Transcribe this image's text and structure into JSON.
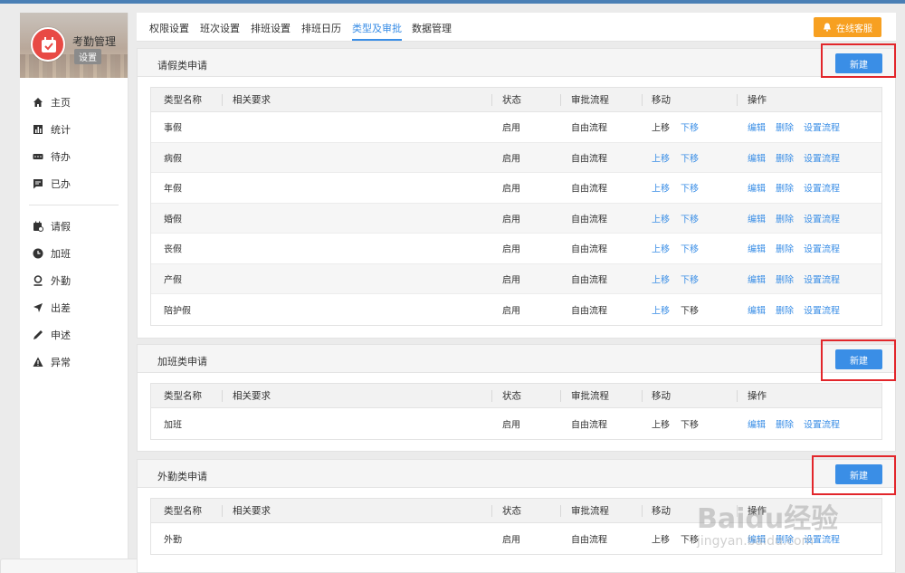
{
  "app": {
    "title": "考勤管理",
    "badge": "设置"
  },
  "nav": {
    "primary": [
      {
        "label": "主页",
        "icon": "home-icon"
      },
      {
        "label": "统计",
        "icon": "chart-icon"
      },
      {
        "label": "待办",
        "icon": "todo-icon"
      },
      {
        "label": "已办",
        "icon": "done-icon"
      }
    ],
    "secondary": [
      {
        "label": "请假",
        "icon": "leave-icon"
      },
      {
        "label": "加班",
        "icon": "clock-icon"
      },
      {
        "label": "外勤",
        "icon": "location-icon"
      },
      {
        "label": "出差",
        "icon": "plane-icon"
      },
      {
        "label": "申述",
        "icon": "pen-icon"
      },
      {
        "label": "异常",
        "icon": "warning-icon"
      }
    ]
  },
  "tabs": [
    "权限设置",
    "班次设置",
    "排班设置",
    "排班日历",
    "类型及审批",
    "数据管理"
  ],
  "active_tab": "类型及审批",
  "service_button": "在线客服",
  "columns": [
    "类型名称",
    "相关要求",
    "状态",
    "审批流程",
    "移动",
    "操作"
  ],
  "actions": {
    "up": "上移",
    "down": "下移",
    "edit": "编辑",
    "delete": "删除",
    "set_flow": "设置流程"
  },
  "sections": [
    {
      "title": "请假类申请",
      "new_button": "新建",
      "rows": [
        {
          "name": "事假",
          "status": "启用",
          "flow": "自由流程"
        },
        {
          "name": "病假",
          "status": "启用",
          "flow": "自由流程"
        },
        {
          "name": "年假",
          "status": "启用",
          "flow": "自由流程"
        },
        {
          "name": "婚假",
          "status": "启用",
          "flow": "自由流程"
        },
        {
          "name": "丧假",
          "status": "启用",
          "flow": "自由流程"
        },
        {
          "name": "产假",
          "status": "启用",
          "flow": "自由流程"
        },
        {
          "name": "陪护假",
          "status": "启用",
          "flow": "自由流程"
        }
      ]
    },
    {
      "title": "加班类申请",
      "new_button": "新建",
      "rows": [
        {
          "name": "加班",
          "status": "启用",
          "flow": "自由流程"
        }
      ]
    },
    {
      "title": "外勤类申请",
      "new_button": "新建",
      "rows": [
        {
          "name": "外勤",
          "status": "启用",
          "flow": "自由流程"
        }
      ]
    }
  ],
  "watermark": {
    "brand": "Baidu经验",
    "url": "jingyan.baidu.com"
  },
  "colors": {
    "accent": "#3a8ee6",
    "service": "#f7a021",
    "highlight": "#e2262b",
    "logo": "#e84a45"
  }
}
